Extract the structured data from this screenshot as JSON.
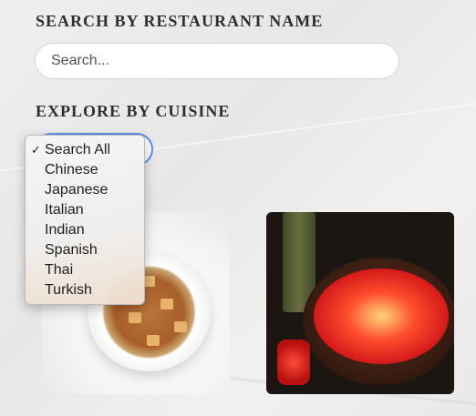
{
  "search": {
    "heading": "SEARCH BY RESTAURANT NAME",
    "placeholder": "Search..."
  },
  "cuisine": {
    "heading": "EXPLORE BY CUISINE",
    "selected": "Search All",
    "check_mark": "✓",
    "options": [
      "Search All",
      "Chinese",
      "Japanese",
      "Italian",
      "Indian",
      "Spanish",
      "Thai",
      "Turkish"
    ]
  },
  "icons": {
    "selected_option": "checkmark-icon"
  },
  "colors": {
    "focus_ring": "#5b8fe8",
    "heading_text": "#2f2f2f"
  }
}
